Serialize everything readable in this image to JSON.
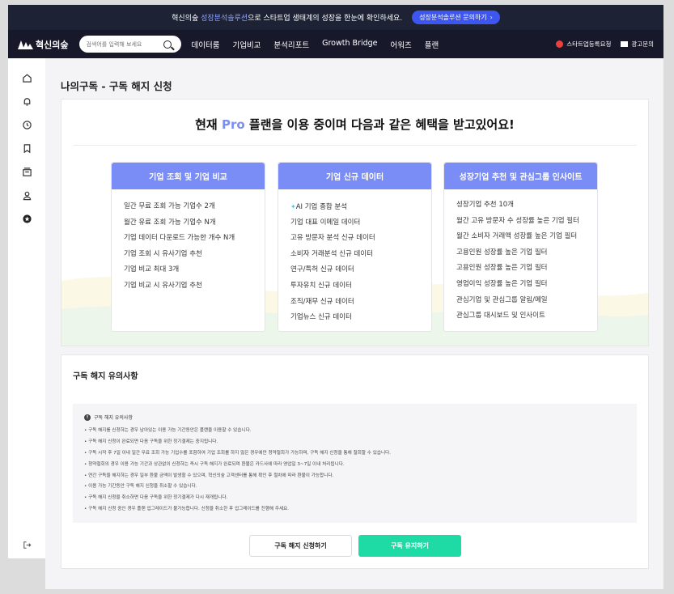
{
  "banner": {
    "text_before": "혁신의숲",
    "text_highlight": "성장분석솔루션",
    "text_after": "으로 스타트업 생태계의 성장을 한눈에 확인하세요.",
    "button_label": "성장분석솔루션 문의하기",
    "button_arrow": "›"
  },
  "nav": {
    "logo_text": "혁신의숲",
    "search_placeholder": "검색어를 입력해 보세요",
    "items": [
      "데이터룸",
      "기업비교",
      "분석리포트",
      "Growth Bridge",
      "어워즈",
      "플랜"
    ],
    "right_items": [
      "스타트업등록요청",
      "광고문의"
    ]
  },
  "sidebar": {
    "icons": [
      "home-icon",
      "bell-icon",
      "history-icon",
      "bookmark-icon",
      "subscription-icon",
      "user-icon",
      "star-badge-icon"
    ],
    "logout_icon": "logout-icon"
  },
  "page": {
    "title": "나의구독 - 구독 해지 신청",
    "headline_before": "현재",
    "headline_pro": "Pro",
    "headline_after": "플랜을 이용 중이며 다음과 같은 혜택을 받고있어요!"
  },
  "cards": [
    {
      "title": "기업 조회 및 기업 비교",
      "items": [
        "일간 무료 조회 가능 기업수 2개",
        "월간 유료 조회 가능 기업수 N개",
        "기업 데이터 다운로드 가능한 개수 N개",
        "기업 조회 시 유사기업 추천",
        "기업 비교 최대 3개",
        "기업 비교 시 유사기업 추천"
      ]
    },
    {
      "title": "기업 신규 데이터",
      "items": [
        "AI 기업 종합 분석",
        "기업 대표 이메일 데이터",
        "고유 방문자 분석 신규 데이터",
        "소비자 거래분석 신규 데이터",
        "연구/특허 신규 데이터",
        "투자유치 신규 데이터",
        "조직/재무 신규 데이터",
        "기업뉴스 신규 데이터"
      ]
    },
    {
      "title": "성장기업 추천 및 관심그룹 인사이트",
      "items": [
        "성장기업 추천 10개",
        "월간 고유 방문자 수 성장률 높은 기업 필터",
        "월간 소비자 거래액 성장률 높은 기업 필터",
        "고용인원 성장률 높은 기업 필터",
        "고용인원 성장률 높은 기업 필터",
        "영업이익 성장률 높은 기업 필터",
        "관심기업 및 관심그룹 알림/메일",
        "관심그룹 대시보드 및 인사이트"
      ]
    }
  ],
  "notice": {
    "section_title": "구독 해지 유의사항",
    "box_title": "구독 해지 유의사항",
    "lines": [
      "• 구독 해지를 신청하는 경우 남아있는 이용 가능 기간동안은 플랜을 이용할 수 있습니다.",
      "• 구독 해지 신청이 완료되면 다음 구독을 위한 정기결제는 중지됩니다.",
      "• 구독 시작 후 7일 이내 일간 무료 조회 가능 기업수를 포함하여 기업 조회를 하지 않은 경우에만 청약철회가 가능하며, 구독 해지 신청을 통해 철회할 수 있습니다.",
      "• 청약철회의 경우 이용 가능 기간과 상관없이 신청하는 즉시 구독 해지가 완료되며 환불은 카드사에 따라 영업일 3~7일 이내 처리됩니다.",
      "• 연간 구독을 해지하는 경우 일부 환불 금액이 발생할 수 있으며, 혁신의숲 고객센터를 통해 확인 후 절차에 따라 환불이 가능합니다.",
      "• 이용 가능 기간동안 구독 해지 신청을 취소할 수 있습니다.",
      "• 구독 해지 신청을 취소하면 다음 구독을 위한 정기결제가 다시 재개됩니다.",
      "• 구독 해지 신청 중인 경우 플랜 업그레이드가 불가능합니다. 신청을 취소한 후 업그레이드를 진행해 주세요."
    ]
  },
  "buttons": {
    "cancel_label": "구독 해지 신청하기",
    "keep_label": "구독 유지하기"
  }
}
